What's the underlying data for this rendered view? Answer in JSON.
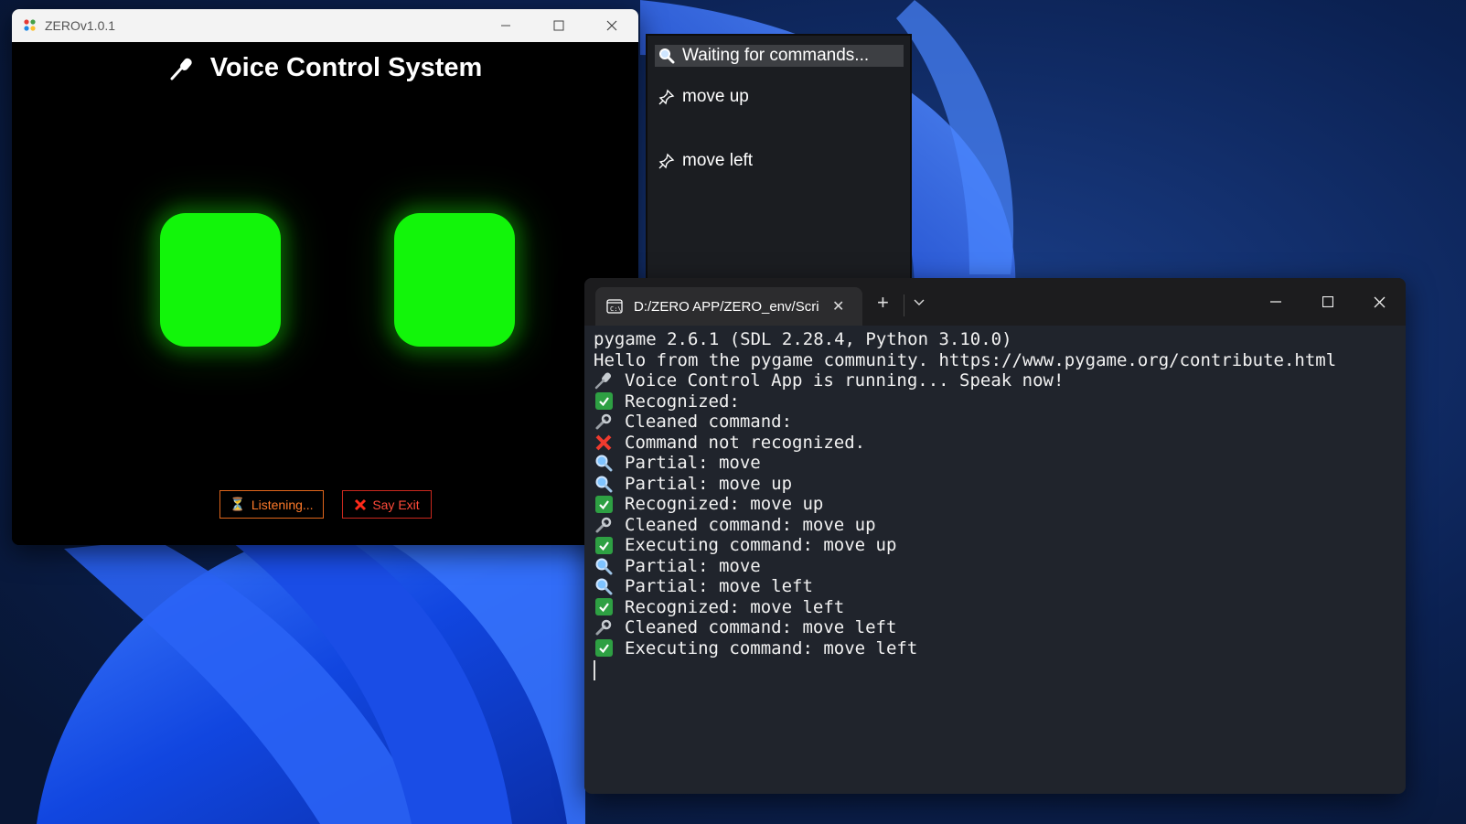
{
  "zero_window": {
    "title": "ZEROv1.0.1",
    "heading": "Voice Control System",
    "buttons": {
      "listening": "Listening...",
      "exit": "Say Exit"
    }
  },
  "command_overlay": {
    "status": "Waiting for commands...",
    "items": [
      "move up",
      "move left"
    ]
  },
  "terminal": {
    "tab_title": "D:/ZERO APP/ZERO_env/Scrip",
    "lines": [
      {
        "icon": "",
        "text": "pygame 2.6.1 (SDL 2.28.4, Python 3.10.0)"
      },
      {
        "icon": "",
        "text": "Hello from the pygame community. https://www.pygame.org/contribute.html"
      },
      {
        "icon": "mic-icon",
        "text": "Voice Control App is running... Speak now!"
      },
      {
        "icon": "check-icon",
        "text": "Recognized:"
      },
      {
        "icon": "wrench-icon",
        "text": "Cleaned command:"
      },
      {
        "icon": "cross-icon",
        "text": "Command not recognized."
      },
      {
        "icon": "magnifier-icon",
        "text": "Partial: move"
      },
      {
        "icon": "magnifier-icon",
        "text": "Partial: move up"
      },
      {
        "icon": "check-icon",
        "text": "Recognized: move up"
      },
      {
        "icon": "wrench-icon",
        "text": "Cleaned command: move up"
      },
      {
        "icon": "check-icon",
        "text": "Executing command: move up"
      },
      {
        "icon": "magnifier-icon",
        "text": "Partial: move"
      },
      {
        "icon": "magnifier-icon",
        "text": "Partial: move left"
      },
      {
        "icon": "check-icon",
        "text": "Recognized: move left"
      },
      {
        "icon": "wrench-icon",
        "text": "Cleaned command: move left"
      },
      {
        "icon": "check-icon",
        "text": "Executing command: move left"
      }
    ]
  },
  "colors": {
    "eye_green": "#12f50a",
    "listening_orange": "#ff7a2a",
    "exit_red": "#ff4a3a",
    "terminal_bg": "#20242c",
    "check_green": "#2ea043"
  }
}
